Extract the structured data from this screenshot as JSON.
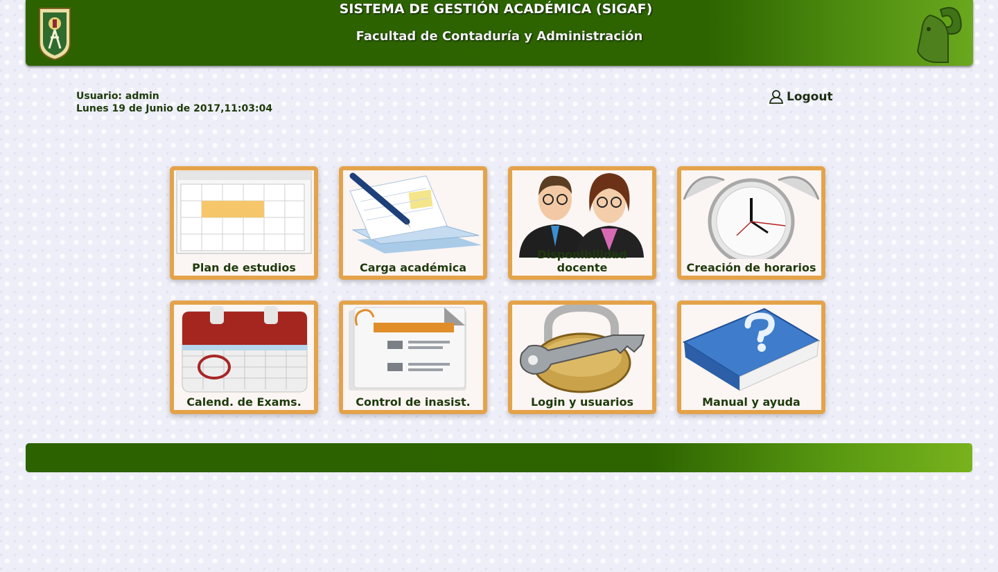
{
  "header": {
    "title": "SISTEMA DE GESTIÓN ACADÉMICA (SIGAF)",
    "subtitle": "Facultad de Contaduría y Administración"
  },
  "user": {
    "usuario": "Usuario: admin",
    "fecha": "Lunes 19 de Junio de 2017,11:03:04"
  },
  "logout": {
    "label": "Logout",
    "icon": "user-outline-icon"
  },
  "tiles": [
    {
      "label": "Plan de estudios",
      "icon": "calendar-grid-icon"
    },
    {
      "label": "Carga académica",
      "icon": "pen-documents-icon"
    },
    {
      "label": "Disponibilidad docente",
      "icon": "teachers-icon"
    },
    {
      "label": "Creación de horarios",
      "icon": "alarm-clock-icon"
    },
    {
      "label": "Calend. de Exams.",
      "icon": "exam-calendar-icon"
    },
    {
      "label": "Control de inasist.",
      "icon": "attendance-form-icon"
    },
    {
      "label": "Login y usuarios",
      "icon": "padlock-key-icon"
    },
    {
      "label": "Manual y ayuda",
      "icon": "help-book-icon"
    }
  ],
  "colors": {
    "header_green": "#2d6400",
    "tile_border": "#e4a34a",
    "text_dark_green": "#1e3a0c"
  }
}
